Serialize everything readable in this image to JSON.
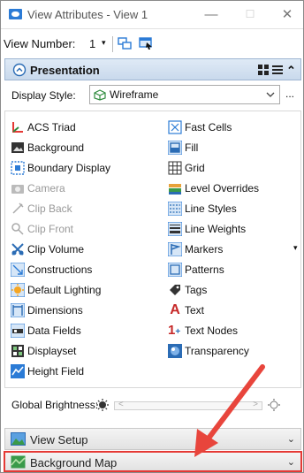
{
  "window": {
    "title": "View Attributes - View 1",
    "minimize": "—",
    "maximize": "☐",
    "close": "✕"
  },
  "toolbar": {
    "view_number_label": "View Number:",
    "view_number_value": "1",
    "caret": "▾"
  },
  "presentation": {
    "title": "Presentation",
    "collapse_glyph": "⌃"
  },
  "display_style": {
    "label": "Display Style:",
    "value": "Wireframe",
    "more": "..."
  },
  "attributes_left": [
    {
      "label": "ACS Triad",
      "icon": "acs-triad-icon",
      "enabled": true
    },
    {
      "label": "Background",
      "icon": "background-icon",
      "enabled": true
    },
    {
      "label": "Boundary Display",
      "icon": "boundary-display-icon",
      "enabled": true
    },
    {
      "label": "Camera",
      "icon": "camera-icon",
      "enabled": false
    },
    {
      "label": "Clip Back",
      "icon": "clip-back-icon",
      "enabled": false
    },
    {
      "label": "Clip Front",
      "icon": "clip-front-icon",
      "enabled": false
    },
    {
      "label": "Clip Volume",
      "icon": "clip-volume-icon",
      "enabled": true
    },
    {
      "label": "Constructions",
      "icon": "constructions-icon",
      "enabled": true
    },
    {
      "label": "Default Lighting",
      "icon": "default-lighting-icon",
      "enabled": true
    },
    {
      "label": "Dimensions",
      "icon": "dimensions-icon",
      "enabled": true
    },
    {
      "label": "Data Fields",
      "icon": "data-fields-icon",
      "enabled": true
    },
    {
      "label": "Displayset",
      "icon": "displayset-icon",
      "enabled": true
    },
    {
      "label": "Height Field",
      "icon": "height-field-icon",
      "enabled": true
    }
  ],
  "attributes_right": [
    {
      "label": "Fast Cells",
      "icon": "fast-cells-icon",
      "enabled": true
    },
    {
      "label": "Fill",
      "icon": "fill-icon",
      "enabled": true
    },
    {
      "label": "Grid",
      "icon": "grid-icon",
      "enabled": true
    },
    {
      "label": "Level Overrides",
      "icon": "level-overrides-icon",
      "enabled": true
    },
    {
      "label": "Line Styles",
      "icon": "line-styles-icon",
      "enabled": true
    },
    {
      "label": "Line Weights",
      "icon": "line-weights-icon",
      "enabled": true
    },
    {
      "label": "Markers",
      "icon": "markers-icon",
      "enabled": true
    },
    {
      "label": "Patterns",
      "icon": "patterns-icon",
      "enabled": true
    },
    {
      "label": "Tags",
      "icon": "tags-icon",
      "enabled": true
    },
    {
      "label": "Text",
      "icon": "text-icon",
      "enabled": true
    },
    {
      "label": "Text Nodes",
      "icon": "text-nodes-icon",
      "enabled": true
    },
    {
      "label": "Transparency",
      "icon": "transparency-icon",
      "enabled": true
    }
  ],
  "brightness": {
    "label": "Global Brightness:",
    "left_arrow": "<",
    "right_arrow": ">"
  },
  "view_setup": {
    "title": "View Setup",
    "expand_glyph": "⌄"
  },
  "background_map": {
    "title": "Background Map",
    "expand_glyph": "⌄"
  },
  "colors": {
    "accent": "#2b7bd6",
    "header_active": "#c9d9ec",
    "highlight_border": "#e53935",
    "arrow": "#e8453c"
  }
}
